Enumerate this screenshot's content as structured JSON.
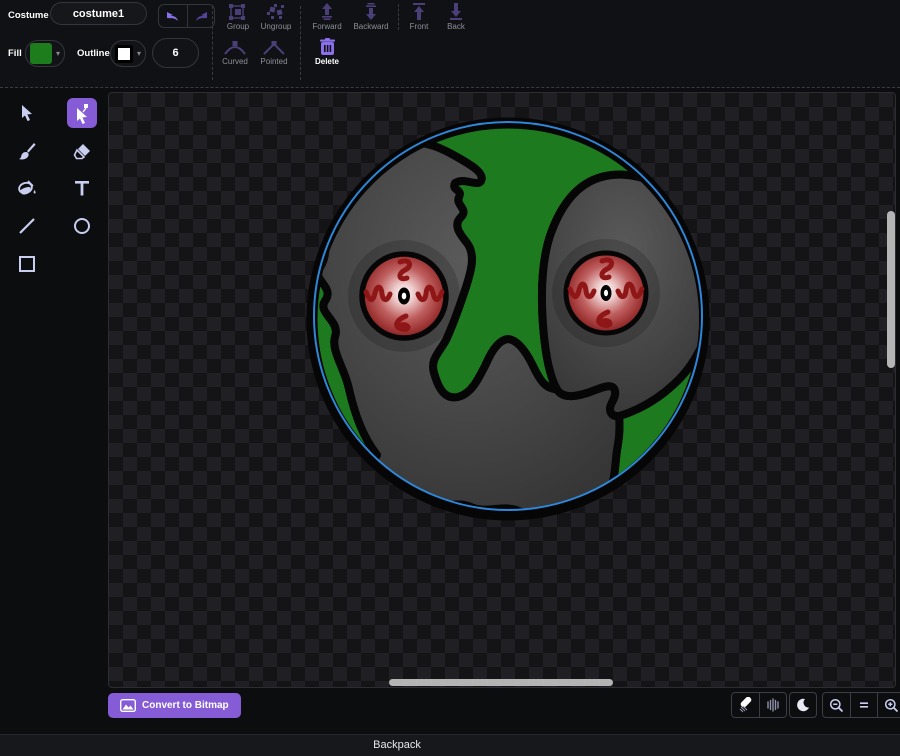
{
  "header": {
    "costume_label": "Costume",
    "costume_name": "costume1",
    "group_label": "Group",
    "ungroup_label": "Ungroup",
    "forward_label": "Forward",
    "backward_label": "Backward",
    "front_label": "Front",
    "back_label": "Back",
    "fill_label": "Fill",
    "outline_label": "Outline",
    "stroke_width": "6",
    "curved_label": "Curved",
    "pointed_label": "Pointed",
    "delete_label": "Delete"
  },
  "tools": {
    "selected": "reshape",
    "items": [
      "select",
      "reshape",
      "brush",
      "eraser",
      "fill",
      "text",
      "line",
      "circle",
      "rectangle"
    ]
  },
  "footer": {
    "convert_label": "Convert to Bitmap"
  },
  "backpack": {
    "label": "Backpack"
  },
  "colors": {
    "accent": "#855cd6",
    "fill_swatch": "#1d7d1d",
    "outline_swatch": "#ffffff",
    "selection_blue": "#2e86d8",
    "artwork_green": "#1e7a1e",
    "artwork_gray": "#464646",
    "eye_red": "#a03636",
    "vein_red": "#8e1616",
    "tool_icon": "#c9cdf0",
    "disabled_icon": "#4b3f78",
    "enabled_icon": "#8a70e8"
  }
}
